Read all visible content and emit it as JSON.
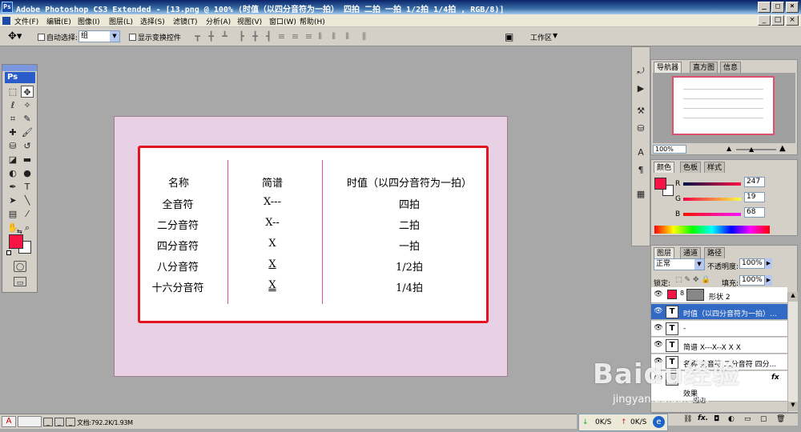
{
  "window": {
    "title": "Adobe Photoshop CS3 Extended - [13.png @ 100% (时值（以四分音符为一拍） 四拍 二拍 一拍 1/2拍 1/4拍 , RGB/8)]",
    "app_icon": "Ps",
    "minimize": "_",
    "restore": "□",
    "close": "×"
  },
  "menu": [
    "文件(F)",
    "编辑(E)",
    "图像(I)",
    "图层(L)",
    "选择(S)",
    "滤镜(T)",
    "分析(A)",
    "视图(V)",
    "窗口(W)",
    "帮助(H)"
  ],
  "options": {
    "auto_select_label": "自动选择:",
    "auto_select_value": "组",
    "show_transform_label": "显示变换控件",
    "workspace_label": "工作区"
  },
  "toolbox": {
    "logo": "Ps"
  },
  "document": {
    "headers": [
      "名称",
      "简谱",
      "时值（以四分音符为一拍）"
    ],
    "rows": [
      [
        "全音符",
        "X---",
        "四拍"
      ],
      [
        "二分音符",
        "X--",
        "二拍"
      ],
      [
        "四分音符",
        "X",
        "一拍"
      ],
      [
        "八分音符",
        "X",
        "1/2拍"
      ],
      [
        "十六分音符",
        "X",
        "1/4拍"
      ]
    ]
  },
  "navigator": {
    "tabs": [
      "导航器",
      "直方图",
      "信息"
    ],
    "zoom": "100%"
  },
  "color_panel": {
    "tabs": [
      "颜色",
      "色板",
      "样式"
    ],
    "r_label": "R",
    "r": "247",
    "g_label": "G",
    "g": "19",
    "b_label": "B",
    "b": "68",
    "foreground": "#f71344"
  },
  "layers_panel": {
    "tabs": [
      "图层",
      "通道",
      "路径"
    ],
    "blend_mode": "正常",
    "opacity_label": "不透明度:",
    "opacity": "100%",
    "lock_label": "锁定:",
    "fill_label": "填充:",
    "fill": "100%",
    "layers": [
      {
        "name": "形状 2",
        "thumb": "■"
      },
      {
        "name": "时值（以四分音符为一拍）...",
        "thumb": "T"
      },
      {
        "name": "-",
        "thumb": "T"
      },
      {
        "name": "简谱 X---X--X X X",
        "thumb": "T"
      },
      {
        "name": "名称 全音符 二分音符 四分...",
        "thumb": "T"
      }
    ],
    "effect_label": "效果",
    "stroke_label": "描边",
    "fx": "fx"
  },
  "status": {
    "doc_size": "文档:792.2K/1.93M",
    "net_down": "0K/S",
    "net_up": "0K/S"
  },
  "watermark": {
    "brand": "Baidu经验",
    "url": "jingyan.baidu.com"
  },
  "colors": {
    "accent_red": "#e3141f",
    "card_bg": "#e8d1e4",
    "divider": "#e0509a",
    "selection": "#316ac5"
  }
}
